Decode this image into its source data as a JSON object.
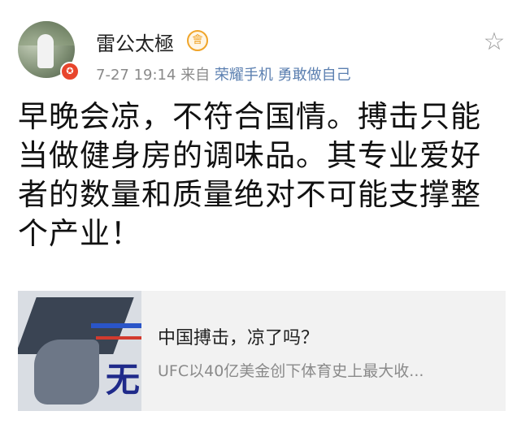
{
  "post": {
    "author_name": "雷公太極",
    "vip_badge": "會",
    "verified_badge": "✪",
    "time": "7-27 19:14",
    "source_prefix": "来自",
    "source": "荣耀手机 勇敢做自己",
    "content": "早晚会凉，不符合国情。搏击只能当做健身房的调味品。其专业爱好者的数量和质量绝对不可能支撑整个产业！",
    "favorite_icon": "star-icon"
  },
  "card": {
    "title": "中国搏击，凉了吗？",
    "subtitle": "UFC以40亿美金创下体育史上最大收...",
    "thumb_glyph": "无"
  }
}
